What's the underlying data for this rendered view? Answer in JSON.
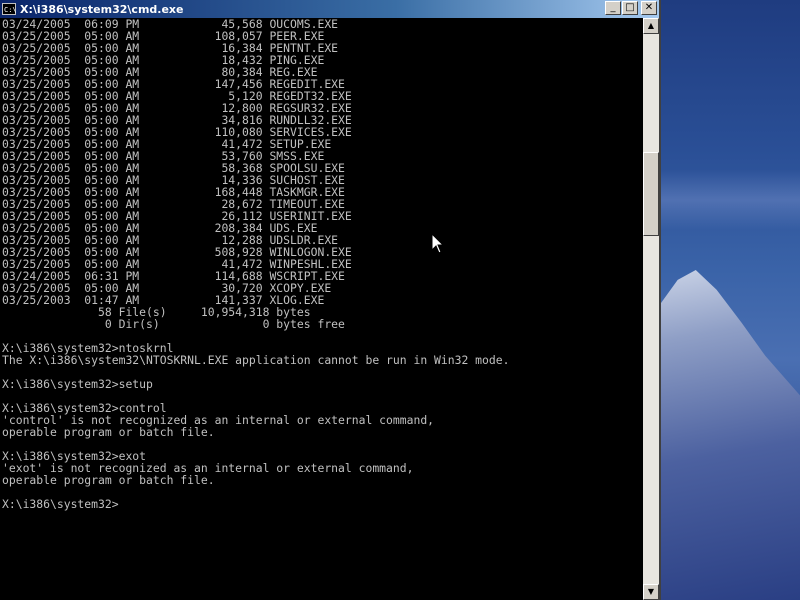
{
  "window": {
    "title": "X:\\i386\\system32\\cmd.exe",
    "icon_text": "C:\\",
    "buttons": {
      "minimize": "_",
      "maximize": "□",
      "close": "✕"
    }
  },
  "scrollbar": {
    "up": "▲",
    "down": "▼"
  },
  "console": {
    "lines": [
      "03/24/2005  06:09 PM            45,568 OUCOMS.EXE",
      "03/25/2005  05:00 AM           108,057 PEER.EXE",
      "03/25/2005  05:00 AM            16,384 PENTNT.EXE",
      "03/25/2005  05:00 AM            18,432 PING.EXE",
      "03/25/2005  05:00 AM            80,384 REG.EXE",
      "03/25/2005  05:00 AM           147,456 REGEDIT.EXE",
      "03/25/2005  05:00 AM             5,120 REGEDT32.EXE",
      "03/25/2005  05:00 AM            12,800 REGSUR32.EXE",
      "03/25/2005  05:00 AM            34,816 RUNDLL32.EXE",
      "03/25/2005  05:00 AM           110,080 SERVICES.EXE",
      "03/25/2005  05:00 AM            41,472 SETUP.EXE",
      "03/25/2005  05:00 AM            53,760 SMSS.EXE",
      "03/25/2005  05:00 AM            58,368 SPOOLSU.EXE",
      "03/25/2005  05:00 AM            14,336 SUCHOST.EXE",
      "03/25/2005  05:00 AM           168,448 TASKMGR.EXE",
      "03/25/2005  05:00 AM            28,672 TIMEOUT.EXE",
      "03/25/2005  05:00 AM            26,112 USERINIT.EXE",
      "03/25/2005  05:00 AM           208,384 UDS.EXE",
      "03/25/2005  05:00 AM            12,288 UDSLDR.EXE",
      "03/25/2005  05:00 AM           508,928 WINLOGON.EXE",
      "03/25/2005  05:00 AM            41,472 WINPESHL.EXE",
      "03/24/2005  06:31 PM           114,688 WSCRIPT.EXE",
      "03/25/2005  05:00 AM            30,720 XCOPY.EXE",
      "03/25/2003  01:47 AM           141,337 XLOG.EXE",
      "              58 File(s)     10,954,318 bytes",
      "               0 Dir(s)               0 bytes free",
      "",
      "X:\\i386\\system32>ntoskrnl",
      "The X:\\i386\\system32\\NTOSKRNL.EXE application cannot be run in Win32 mode.",
      "",
      "X:\\i386\\system32>setup",
      "",
      "X:\\i386\\system32>control",
      "'control' is not recognized as an internal or external command,",
      "operable program or batch file.",
      "",
      "X:\\i386\\system32>exot",
      "'exot' is not recognized as an internal or external command,",
      "operable program or batch file.",
      "",
      "X:\\i386\\system32>"
    ]
  }
}
